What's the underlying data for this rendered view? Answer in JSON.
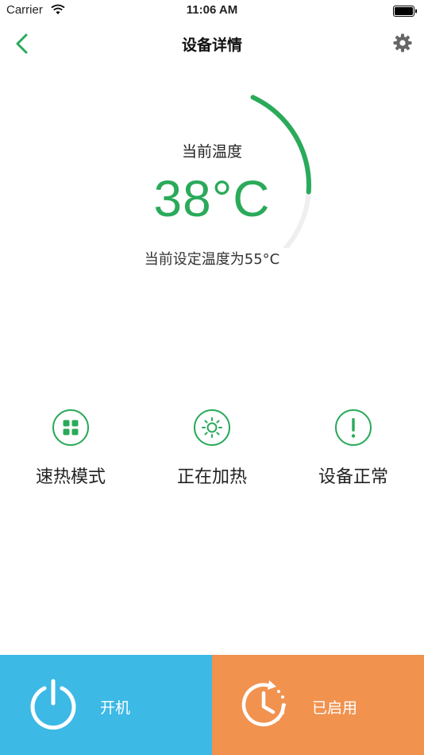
{
  "status_bar": {
    "carrier": "Carrier",
    "time": "11:06 AM"
  },
  "nav": {
    "title": "设备详情",
    "back_icon": "chevron-left-icon",
    "settings_icon": "gear-icon"
  },
  "gauge": {
    "label": "当前温度",
    "value": "38°C",
    "setpoint_text": "当前设定温度为55°C",
    "fill_fraction": 0.3,
    "colors": {
      "active": "#2aaa5a",
      "track": "#efefef"
    }
  },
  "status_items": [
    {
      "label": "速热模式",
      "icon": "grid-icon"
    },
    {
      "label": "正在加热",
      "icon": "sun-icon"
    },
    {
      "label": "设备正常",
      "icon": "exclamation-icon"
    }
  ],
  "bottom": {
    "power": {
      "label": "开机",
      "icon": "power-icon",
      "color": "#3db9e6"
    },
    "timer": {
      "label": "已启用",
      "icon": "timer-icon",
      "color": "#f1924f"
    }
  },
  "colors": {
    "accent": "#2aaa5a"
  }
}
